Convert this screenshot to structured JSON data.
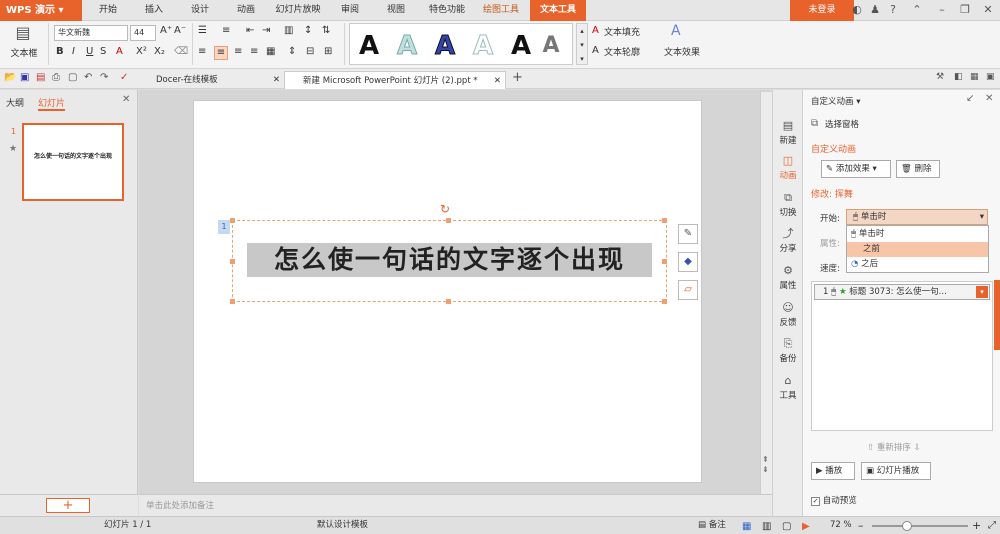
{
  "app": {
    "name": "WPS 演示",
    "dropdown": "▾"
  },
  "menu": [
    "开始",
    "插入",
    "设计",
    "动画",
    "幻灯片放映",
    "审阅",
    "视图",
    "特色功能",
    "绘图工具",
    "文本工具"
  ],
  "login": "未登录",
  "ribbon": {
    "textbox_label": "文本框",
    "font_name": "华文新魏",
    "font_size": "44",
    "fill_label": "文本填充",
    "outline_label": "文本轮廓",
    "effect_label": "文本效果",
    "wordart_glyph": "A"
  },
  "tabs": [
    {
      "label": "Docer-在线模板"
    },
    {
      "label": "新建 Microsoft PowerPoint 幻灯片 (2).ppt *"
    }
  ],
  "left_panel": {
    "tab_outline": "大纲",
    "tab_slides": "幻灯片",
    "slide_number": "1",
    "star": "★"
  },
  "slide": {
    "text": "怎么使一句话的文字逐个出现",
    "anim_badge": "1"
  },
  "notes_placeholder": "单击此处添加备注",
  "iconcol": [
    "新建",
    "动画",
    "切换",
    "分享",
    "属性",
    "反馈",
    "备份",
    "工具"
  ],
  "pane": {
    "title": "自定义动画",
    "select_pane": "选择窗格",
    "section_custom": "自定义动画",
    "add_effect": "添加效果",
    "delete": "删除",
    "modify": "修改: 挥舞",
    "start_label": "开始:",
    "start_value": "单击时",
    "property_label": "属性:",
    "speed_label": "速度:",
    "start_options": [
      "单击时",
      "之前",
      "之后"
    ],
    "list_item": {
      "index": "1",
      "text": "标题 3073: 怎么使一句..."
    },
    "reorder": "重新排序",
    "play_label": "播放",
    "slideshow_label": "幻灯片播放",
    "autopreview": "自动预览"
  },
  "status": {
    "slide_counter": "幻灯片 1 / 1",
    "template": "默认设计模板",
    "notes": "备注",
    "zoom": "72 %"
  },
  "colors": {
    "accent": "#e8632b",
    "selection": "#f7c6a8"
  }
}
